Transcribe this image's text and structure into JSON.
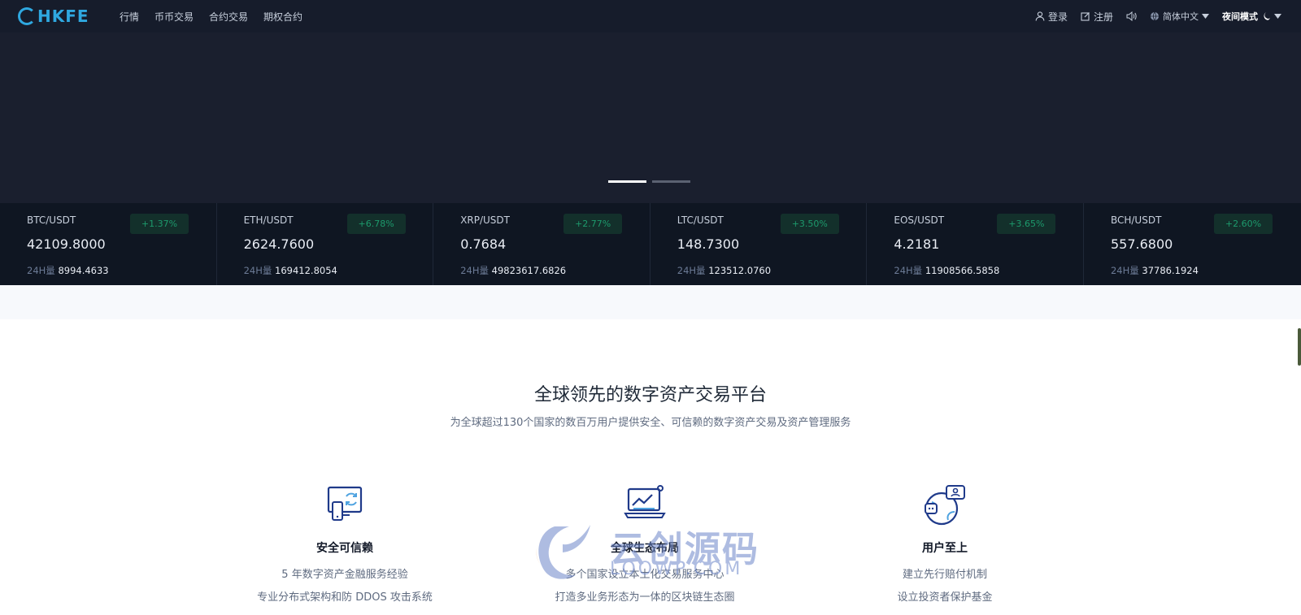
{
  "nav": {
    "logo_text": "HKFE",
    "links": [
      "行情",
      "币币交易",
      "合约交易",
      "期权合约"
    ],
    "login": "登录",
    "register": "注册",
    "language": "简体中文",
    "night_mode": "夜间模式"
  },
  "ticker": [
    {
      "pair": "BTC/USDT",
      "change": "+1.37%",
      "price": "42109.8000",
      "vol_label": "24H量",
      "vol": "8994.4633"
    },
    {
      "pair": "ETH/USDT",
      "change": "+6.78%",
      "price": "2624.7600",
      "vol_label": "24H量",
      "vol": "169412.8054"
    },
    {
      "pair": "XRP/USDT",
      "change": "+2.77%",
      "price": "0.7684",
      "vol_label": "24H量",
      "vol": "49823617.6826"
    },
    {
      "pair": "LTC/USDT",
      "change": "+3.50%",
      "price": "148.7300",
      "vol_label": "24H量",
      "vol": "123512.0760"
    },
    {
      "pair": "EOS/USDT",
      "change": "+3.65%",
      "price": "4.2181",
      "vol_label": "24H量",
      "vol": "11908566.5858"
    },
    {
      "pair": "BCH/USDT",
      "change": "+2.60%",
      "price": "557.6800",
      "vol_label": "24H量",
      "vol": "37786.1924"
    }
  ],
  "hero": {
    "title": "全球领先的数字资产交易平台",
    "subtitle": "为全球超过130个国家的数百万用户提供安全、可信赖的数字资产交易及资产管理服务"
  },
  "features": [
    {
      "title": "安全可信赖",
      "line1": "5 年数字资产金融服务经验",
      "line2": "专业分布式架构和防 DDOS 攻击系统"
    },
    {
      "title": "全球生态布局",
      "line1": "多个国家设立本土化交易服务中心",
      "line2": "打造多业务形态为一体的区块链生态圈"
    },
    {
      "title": "用户至上",
      "line1": "建立先行赔付机制",
      "line2": "设立投资者保护基金"
    }
  ],
  "watermark": {
    "text": "云创源码",
    "sub": "LOOWP.COM"
  },
  "colors": {
    "nav_bg": "#161c2b",
    "banner_bg": "#1a1f2e",
    "ticker_bg": "#0f1622",
    "accent": "#2fa8e0",
    "up": "#1d9a6c"
  }
}
